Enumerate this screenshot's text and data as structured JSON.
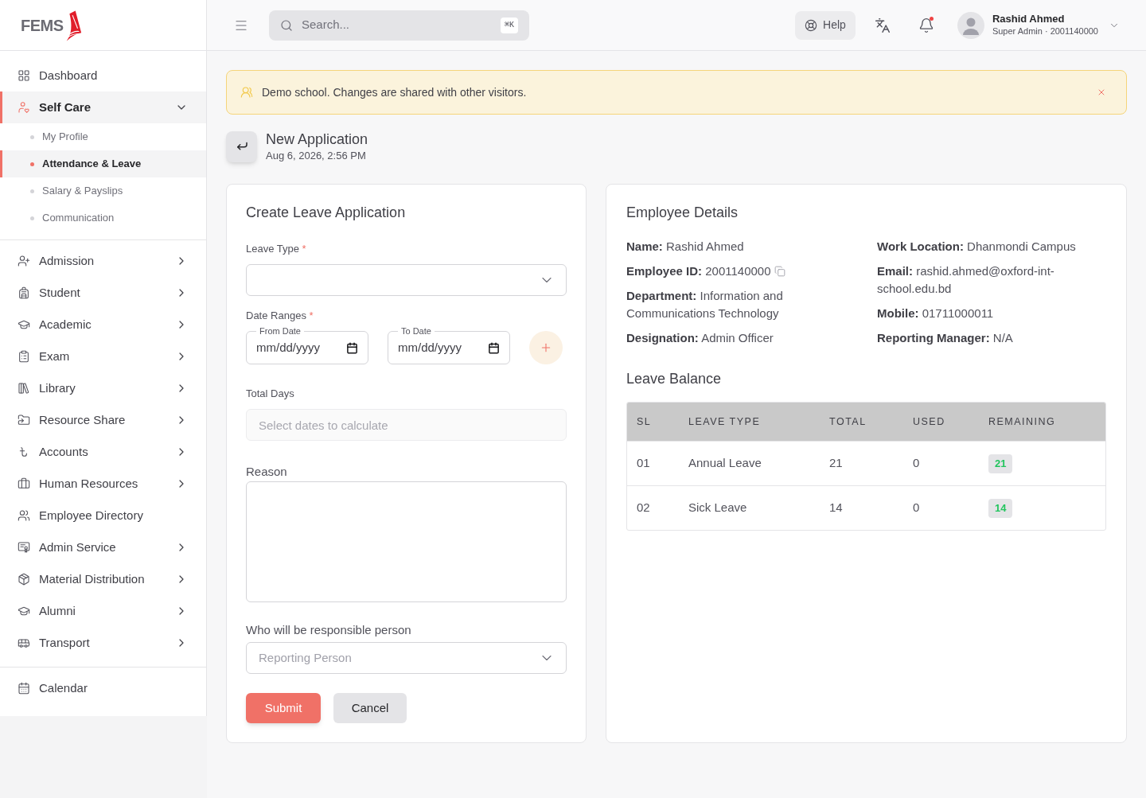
{
  "sidebar": {
    "logo": "FEMS",
    "sections": [
      {
        "items": [
          {
            "label": "Dashboard",
            "kind": "link",
            "selected": false
          },
          {
            "label": "Self Care",
            "kind": "group",
            "selected": true,
            "expanded": true,
            "children": [
              {
                "label": "My Profile",
                "selected": false
              },
              {
                "label": "Attendance & Leave",
                "selected": true
              },
              {
                "label": "Salary & Payslips",
                "selected": false
              },
              {
                "label": "Communication",
                "selected": false
              }
            ]
          }
        ]
      },
      {
        "items": [
          {
            "label": "Admission",
            "kind": "group",
            "selected": false,
            "expanded": false
          },
          {
            "label": "Student",
            "kind": "group",
            "selected": false,
            "expanded": false
          },
          {
            "label": "Academic",
            "kind": "group",
            "selected": false,
            "expanded": false
          },
          {
            "label": "Exam",
            "kind": "group",
            "selected": false,
            "expanded": false
          },
          {
            "label": "Library",
            "kind": "group",
            "selected": false,
            "expanded": false
          },
          {
            "label": "Resource Share",
            "kind": "group",
            "selected": false,
            "expanded": false
          },
          {
            "label": "Accounts",
            "kind": "group",
            "selected": false,
            "expanded": false
          },
          {
            "label": "Human Resources",
            "kind": "group",
            "selected": false,
            "expanded": false
          },
          {
            "label": "Employee Directory",
            "kind": "link",
            "selected": false
          },
          {
            "label": "Admin Service",
            "kind": "group",
            "selected": false,
            "expanded": false
          },
          {
            "label": "Material Distribution",
            "kind": "group",
            "selected": false,
            "expanded": false
          },
          {
            "label": "Alumni",
            "kind": "group",
            "selected": false,
            "expanded": false
          },
          {
            "label": "Transport",
            "kind": "group",
            "selected": false,
            "expanded": false
          }
        ]
      },
      {
        "items": [
          {
            "label": "Calendar",
            "kind": "link",
            "selected": false
          }
        ]
      }
    ]
  },
  "header": {
    "search": {
      "placeholder": "Search...",
      "shortcut": "⌘K"
    },
    "help": "Help",
    "notifications": {
      "unread": true
    },
    "user": {
      "name": "Rashid Ahmed",
      "role": "Super Admin · 2001140000"
    }
  },
  "banner": {
    "message": "Demo school. Changes are shared with other visitors."
  },
  "page_header": {
    "title": "New Application",
    "subtitle": "Aug 6, 2026, 2:56 PM"
  },
  "form": {
    "title": "Create Leave Application",
    "leave_type": {
      "label": "Leave Type",
      "required_mark": "*"
    },
    "date_ranges": {
      "label": "Date Ranges",
      "required_mark": "*",
      "from": {
        "label": "From Date",
        "placeholder": "mm/dd/yyyy"
      },
      "to": {
        "label": "To Date",
        "placeholder": "mm/dd/yyyy"
      }
    },
    "total_days": {
      "label": "Total Days",
      "placeholder": "Select dates to calculate",
      "disabled": true
    },
    "reason": {
      "label": "Reason"
    },
    "responsible": {
      "label": "Who will be responsible person",
      "placeholder": "Reporting Person"
    },
    "buttons": [
      {
        "label": "Submit",
        "kind": "primary"
      },
      {
        "label": "Cancel",
        "kind": "secondary"
      }
    ]
  },
  "employee": {
    "title": "Employee Details",
    "columns": [
      [
        {
          "text": "**Name:** Rashid Ahmed",
          "copyable": false
        },
        {
          "text": "**Employee ID:** 2001140000",
          "copyable": true
        },
        {
          "text": "**Department:** Information and Communications Technology",
          "copyable": false
        },
        {
          "text": "**Designation:** Admin Officer",
          "copyable": false
        }
      ],
      [
        {
          "text": "**Work Location:** Dhanmondi Campus",
          "copyable": false
        },
        {
          "text": "**Email:** rashid.ahmed@oxford-int-school.edu.bd",
          "copyable": false
        },
        {
          "text": "**Mobile:** 01711000011",
          "copyable": false
        },
        {
          "text": "**Reporting Manager:** N/A",
          "copyable": false
        }
      ]
    ]
  },
  "leave_balance": {
    "title": "Leave Balance",
    "columns": [
      "SL",
      "LEAVE TYPE",
      "TOTAL",
      "USED",
      "REMAINING"
    ],
    "rows": [
      {
        "sl": "01",
        "leave_type": "Annual Leave",
        "total": "21",
        "used": "0",
        "remaining": "21"
      },
      {
        "sl": "02",
        "leave_type": "Sick Leave",
        "total": "14",
        "used": "0",
        "remaining": "14"
      }
    ]
  }
}
